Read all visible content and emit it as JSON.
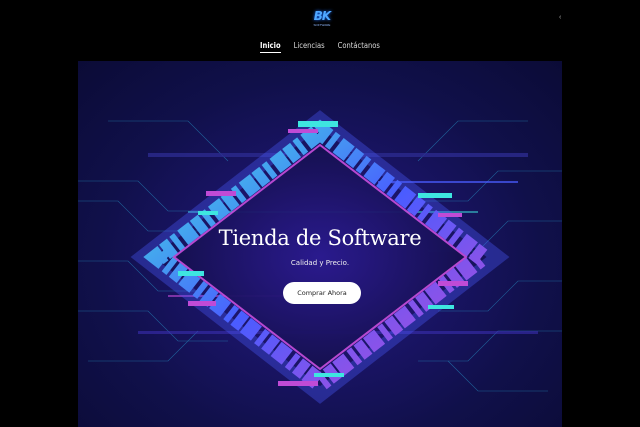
{
  "header": {
    "logo_text": "BK",
    "logo_sub": "SOFTWARE",
    "menu_glyph": "‹"
  },
  "nav": {
    "items": [
      {
        "label": "Inicio",
        "active": true
      },
      {
        "label": "Licencias",
        "active": false
      },
      {
        "label": "Contáctanos",
        "active": false
      }
    ]
  },
  "hero": {
    "title": "Tienda de Software",
    "subtitle": "Calidad y Precio.",
    "cta_label": "Comprar Ahora"
  },
  "colors": {
    "background": "#000000",
    "hero_dark": "#0b0b36",
    "hero_purple": "#2a1d8a",
    "glitch_cyan": "#3ee6e0",
    "glitch_magenta": "#c04bd6",
    "glitch_blue": "#4a5cff",
    "logo_blue": "#4fa7ff"
  },
  "icons": [
    "logo-icon",
    "menu-icon"
  ]
}
